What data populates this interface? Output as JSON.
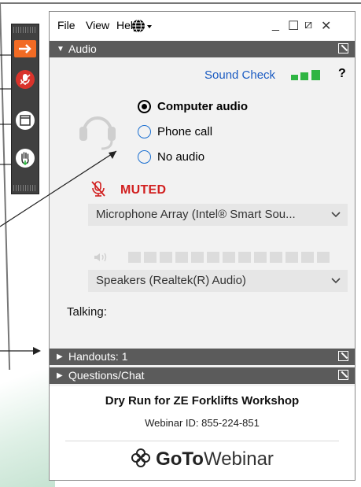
{
  "menu": {
    "file": "File",
    "view": "View",
    "help": "Help"
  },
  "window_controls": {
    "minimize": "_",
    "maximize": "☐",
    "restore": "⧄",
    "close": "✕"
  },
  "audio": {
    "header": "Audio",
    "sound_check": "Sound Check",
    "help_glyph": "?",
    "options": [
      {
        "label": "Computer audio",
        "selected": true
      },
      {
        "label": "Phone call",
        "selected": false
      },
      {
        "label": "No audio",
        "selected": false
      }
    ],
    "muted": "MUTED",
    "microphone": "Microphone Array (Intel® Smart Sou...",
    "speakers": "Speakers (Realtek(R) Audio)",
    "talking": "Talking:"
  },
  "sections": {
    "handouts": "Handouts: 1",
    "questions": "Questions/Chat"
  },
  "webinar": {
    "title": "Dry Run for ZE Forklifts Workshop",
    "id_text": "Webinar ID: 855-224-851"
  },
  "brand": {
    "goto": "GoTo",
    "webinar": "Webinar"
  },
  "colors": {
    "accent": "#f26b24",
    "muted": "#d11f1f",
    "link": "#1a5bc2",
    "signal": "#2fb543"
  }
}
